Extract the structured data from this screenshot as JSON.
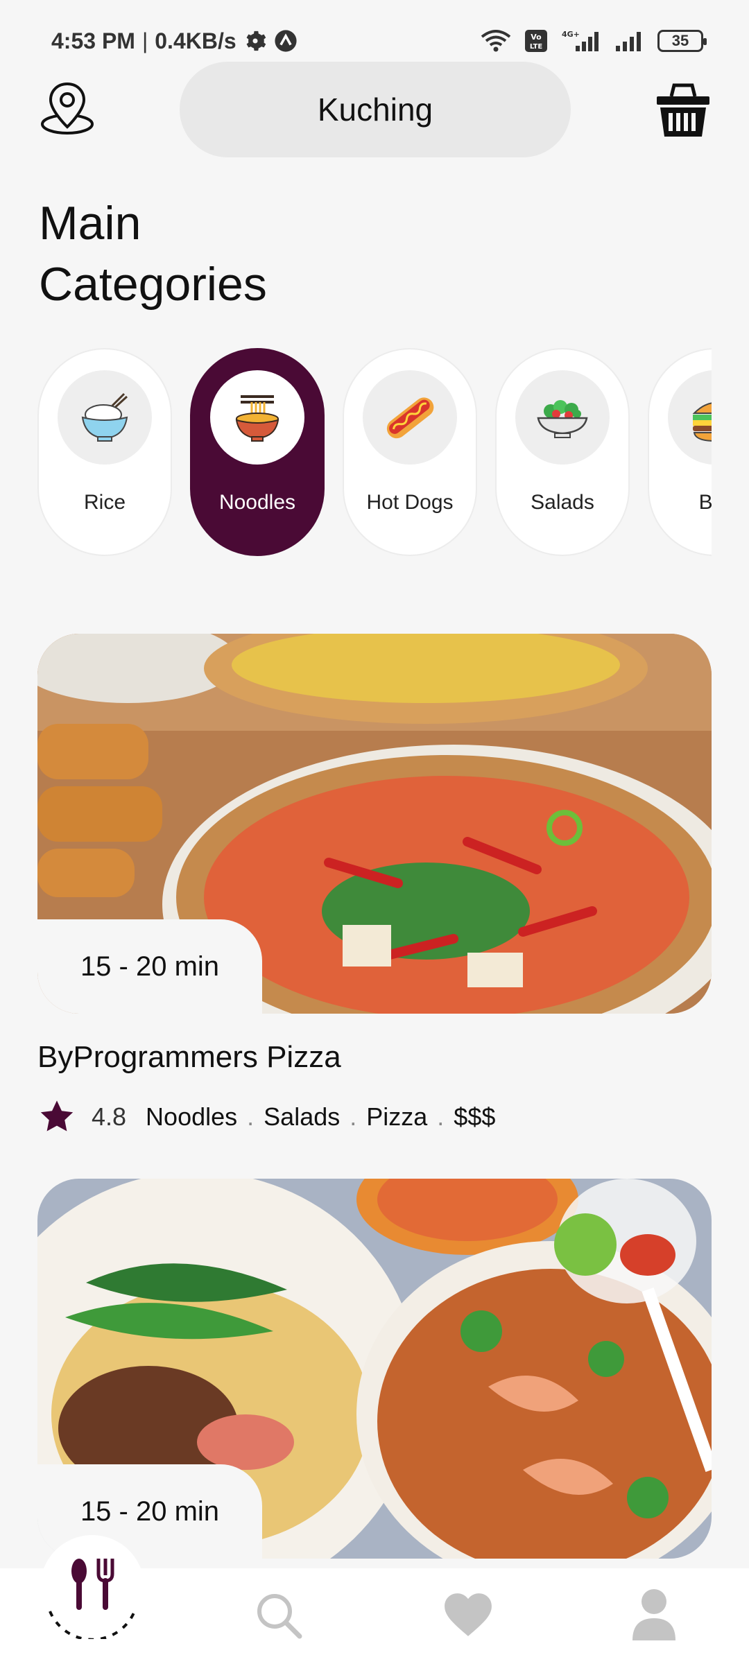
{
  "status_bar": {
    "time": "4:53 PM",
    "separator": "|",
    "speed": "0.4KB/s",
    "battery": "35"
  },
  "header": {
    "location": "Kuching",
    "location_icon": "location-pin-icon",
    "cart_icon": "basket-icon"
  },
  "page": {
    "title_line1": "Main",
    "title_line2": "Categories"
  },
  "categories": [
    {
      "label": "Rice",
      "icon": "rice-bowl-icon",
      "active": false
    },
    {
      "label": "Noodles",
      "icon": "noodles-icon",
      "active": true
    },
    {
      "label": "Hot Dogs",
      "icon": "hot-dog-icon",
      "active": false
    },
    {
      "label": "Salads",
      "icon": "salad-icon",
      "active": false
    },
    {
      "label": "Bur",
      "icon": "burger-icon",
      "active": false
    }
  ],
  "restaurants": [
    {
      "delivery_time": "15 - 20 min",
      "name": "ByProgrammers Pizza",
      "rating": "4.8",
      "categories": [
        "Noodles",
        "Salads",
        "Pizza"
      ],
      "price": "$$$",
      "separator": "."
    },
    {
      "delivery_time": "15 - 20 min"
    }
  ],
  "nav": {
    "items": [
      "home-icon",
      "search-icon",
      "heart-icon",
      "user-icon"
    ]
  },
  "colors": {
    "accent": "#4a0a35",
    "background": "#f6f6f6",
    "pill": "#e8e8e8",
    "inactive_nav": "#c4c4c4"
  }
}
